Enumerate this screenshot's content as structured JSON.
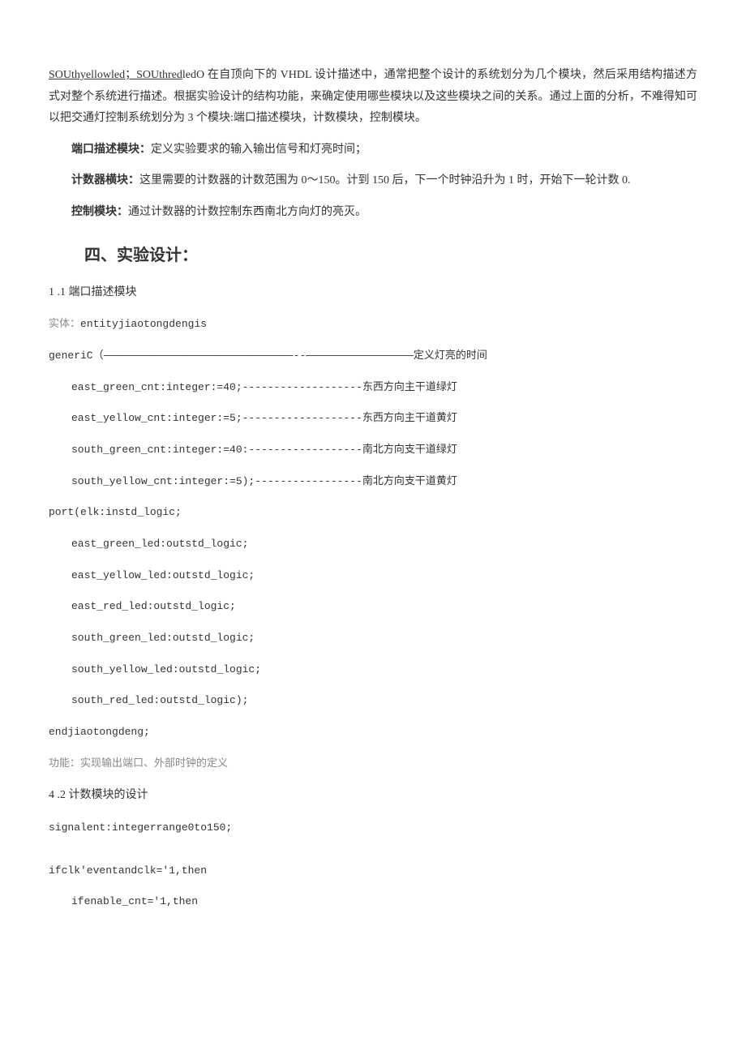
{
  "p1_underline": "SOUthyellowled；SOUthred",
  "p1_rest": "ledO 在自顶向下的 VHDL 设计描述中，通常把整个设计的系统划分为几个模块，然后采用结构描述方式对整个系统进行描述。根据实验设计的结构功能，来确定使用哪些模块以及这些模块之间的关系。通过上面的分析，不难得知可以把交通灯控制系统划分为 3 个模块:端口描述模块，计数模块，控制模块。",
  "p2_bold": "端口描述模块：",
  "p2_rest": "定义实验要求的输入输出信号和灯亮时间；",
  "p3_bold": "计数器横块：",
  "p3_rest": "这里需要的计数器的计数范围为 0～150。计到 150 后，下一个时钟沿升为 1 时，开始下一轮计数 0.",
  "p4_bold": "控制模块：",
  "p4_rest": "通过计数器的计数控制东西南北方向灯的亮灭。",
  "section_title": "四、实验设计：",
  "sub1": "1  .1 端口描述模块",
  "entity_label": "实体：",
  "entity_code": "entityjiaotongdengis",
  "generic_line": "generiC（——————————————————————————————--—————————————————定义灯亮的时间",
  "g1": "east_green_cnt:integer:=40;-------------------东西方向主干道绿灯",
  "g2": "east_yellow_cnt:integer:=5;-------------------东西方向主干道黄灯",
  "g3": "south_green_cnt:integer:=40:------------------南北方向支干道绿灯",
  "g4": "south_yellow_cnt:integer:=5);-----------------南北方向支干道黄灯",
  "port_line": "port(elk:instd_logic;",
  "port1": "east_green_led:outstd_logic;",
  "port2": "east_yellow_led:outstd_logic;",
  "port3": "east_red_led:outstd_logic;",
  "port4": "south_green_led:outstd_logic;",
  "port5": "south_yellow_led:outstd_logic;",
  "port6": "south_red_led:outstd_logic);",
  "end_entity": "endjiaotongdeng;",
  "func_label": "功能：",
  "func_text": "实现输出端口、外部时钟的定义",
  "sub2": "4  .2 计数模块的设计",
  "signal_line": "signalent:integerrange0to150;",
  "if_line": "ifclk'eventandclk='1,then",
  "if_inner": "ifenable_cnt='1,then"
}
